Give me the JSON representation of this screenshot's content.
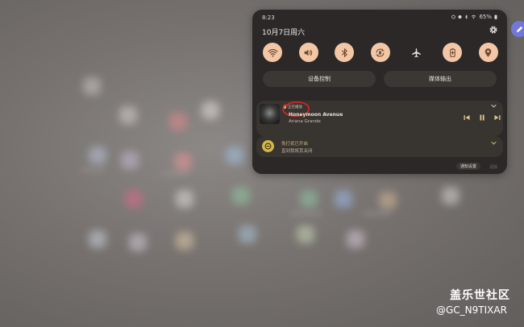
{
  "status_bar": {
    "time": "8:23",
    "battery": "65%"
  },
  "header": {
    "date": "10月7日周六"
  },
  "quick_tiles": [
    {
      "icon": "wifi-icon",
      "active": true
    },
    {
      "icon": "sound-icon",
      "active": true
    },
    {
      "icon": "bluetooth-icon",
      "active": true
    },
    {
      "icon": "auto-rotate-icon",
      "active": true
    },
    {
      "icon": "airplane-icon",
      "active": false
    },
    {
      "icon": "battery-saver-icon",
      "active": true
    },
    {
      "icon": "location-icon",
      "active": true
    }
  ],
  "buttons": {
    "device_control": "设备控制",
    "media_output": "媒体输出"
  },
  "media": {
    "source": "正在播放",
    "title": "Honeymoon Avenue",
    "artist": "Ariana Grande"
  },
  "dnd": {
    "title": "免打扰已开启",
    "subtitle": "直到我将其关闭"
  },
  "footer": {
    "notification_settings": "通知设置",
    "clear": "清除"
  },
  "watermark": {
    "line1": "盖乐世社区",
    "line2": "@GC_N9TIXAR"
  },
  "colors": {
    "tile_active": "#f3c7a5",
    "panel": "#2b2827",
    "accent_yellow": "#d4b846",
    "annotation_red": "#d8262a"
  }
}
